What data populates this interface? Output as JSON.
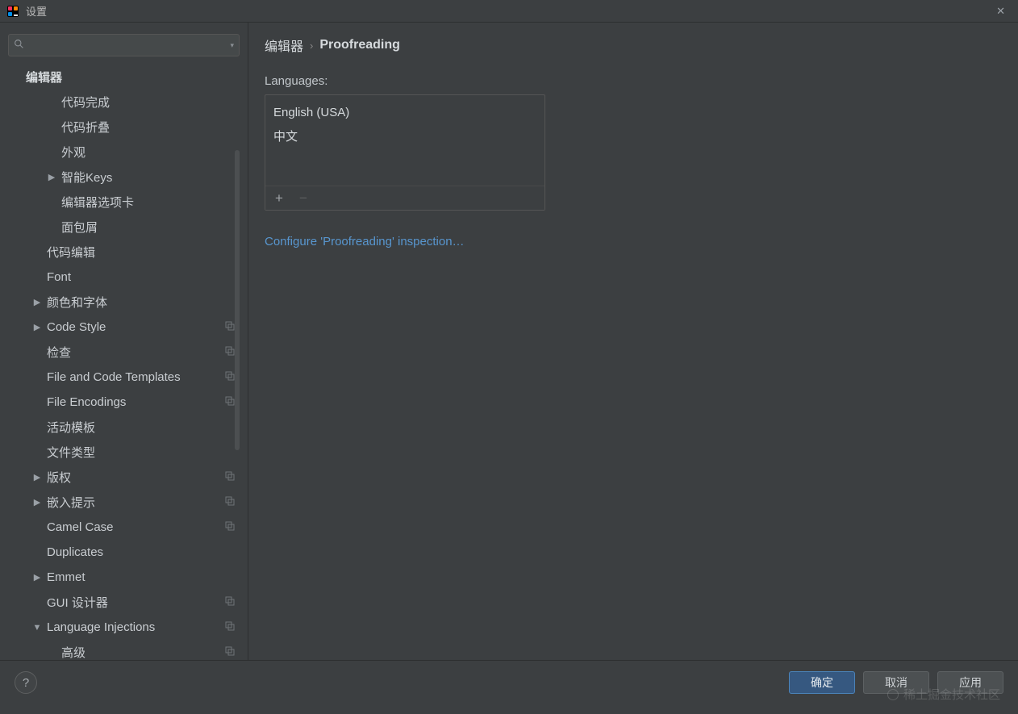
{
  "window": {
    "title": "设置",
    "close_tooltip": "Close"
  },
  "search": {
    "placeholder": ""
  },
  "sidebar": {
    "root_label": "编辑器",
    "items": [
      {
        "label": "代码完成",
        "indent": 2,
        "chev": "",
        "proj": false
      },
      {
        "label": "代码折叠",
        "indent": 2,
        "chev": "",
        "proj": false
      },
      {
        "label": "外观",
        "indent": 2,
        "chev": "",
        "proj": false
      },
      {
        "label": "智能Keys",
        "indent": 2,
        "chev": "right",
        "proj": false
      },
      {
        "label": "编辑器选项卡",
        "indent": 2,
        "chev": "",
        "proj": false
      },
      {
        "label": "面包屑",
        "indent": 2,
        "chev": "",
        "proj": false
      },
      {
        "label": "代码编辑",
        "indent": 1,
        "chev": "",
        "proj": false
      },
      {
        "label": "Font",
        "indent": 1,
        "chev": "",
        "proj": false
      },
      {
        "label": "颜色和字体",
        "indent": 1,
        "chev": "right",
        "proj": false
      },
      {
        "label": "Code Style",
        "indent": 1,
        "chev": "right",
        "proj": true
      },
      {
        "label": "检查",
        "indent": 1,
        "chev": "",
        "proj": true
      },
      {
        "label": "File and Code Templates",
        "indent": 1,
        "chev": "",
        "proj": true
      },
      {
        "label": "File Encodings",
        "indent": 1,
        "chev": "",
        "proj": true
      },
      {
        "label": "活动模板",
        "indent": 1,
        "chev": "",
        "proj": false
      },
      {
        "label": "文件类型",
        "indent": 1,
        "chev": "",
        "proj": false
      },
      {
        "label": "版权",
        "indent": 1,
        "chev": "right",
        "proj": true
      },
      {
        "label": "嵌入提示",
        "indent": 1,
        "chev": "right",
        "proj": true
      },
      {
        "label": "Camel Case",
        "indent": 1,
        "chev": "",
        "proj": true
      },
      {
        "label": "Duplicates",
        "indent": 1,
        "chev": "",
        "proj": false
      },
      {
        "label": "Emmet",
        "indent": 1,
        "chev": "right",
        "proj": false
      },
      {
        "label": "GUI 设计器",
        "indent": 1,
        "chev": "",
        "proj": true
      },
      {
        "label": "Language Injections",
        "indent": 1,
        "chev": "down",
        "proj": true
      },
      {
        "label": "高级",
        "indent": 2,
        "chev": "",
        "proj": true
      }
    ]
  },
  "breadcrumb": {
    "parent": "编辑器",
    "separator": "›",
    "current": "Proofreading"
  },
  "content": {
    "languages_label": "Languages:",
    "languages": [
      "English (USA)",
      "中文"
    ],
    "add_tooltip": "+",
    "remove_tooltip": "−",
    "configure_link": "Configure 'Proofreading' inspection…"
  },
  "footer": {
    "help_label": "?",
    "ok_label": "确定",
    "cancel_label": "取消",
    "apply_label": "应用"
  },
  "watermark": "稀土掘金技术社区"
}
